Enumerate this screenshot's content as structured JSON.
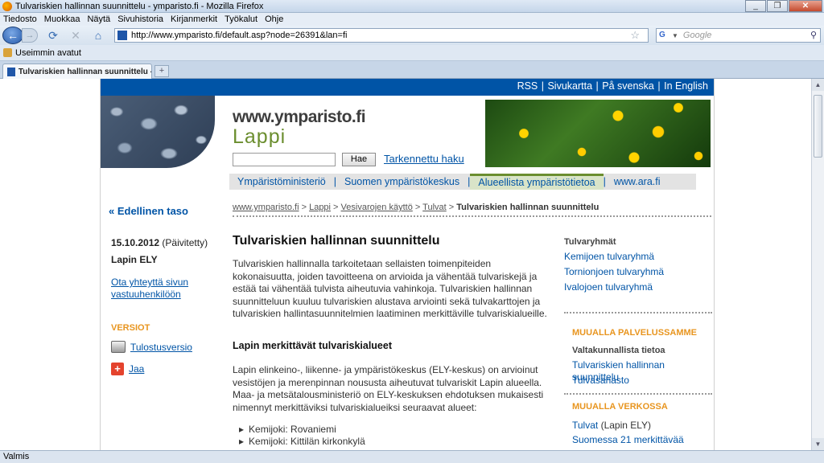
{
  "window": {
    "title": "Tulvariskien hallinnan suunnittelu - ymparisto.fi - Mozilla Firefox",
    "minimize": "_",
    "maximize": "❐",
    "close": "✕"
  },
  "menu": [
    "Tiedosto",
    "Muokkaa",
    "Näytä",
    "Sivuhistoria",
    "Kirjanmerkit",
    "Työkalut",
    "Ohje"
  ],
  "navbar": {
    "url": "http://www.ymparisto.fi/default.asp?node=26391&lan=fi",
    "search_placeholder": "Google"
  },
  "bookmarks": {
    "label": "Useimmin avatut"
  },
  "tab": {
    "label": "Tulvariskien hallinnan suunnittelu - y..."
  },
  "status": "Valmis",
  "page": {
    "top_links": [
      "RSS",
      "Sivukartta",
      "På svenska",
      "In English"
    ],
    "logo": {
      "domain": "www.ymparisto.fi",
      "region": "Lappi"
    },
    "search_button": "Hae",
    "advanced_search": "Tarkennettu haku",
    "main_nav": [
      "Ympäristöministeriö",
      "Suomen ympäristökeskus",
      "Alueellista ympäristötietoa",
      "www.ara.fi"
    ],
    "back_level": "« Edellinen taso",
    "breadcrumb": [
      "www.ymparisto.fi",
      "Lappi",
      "Vesivarojen käyttö",
      "Tulvat"
    ],
    "breadcrumb_current": "Tulvariskien hallinnan suunnittelu",
    "date": "15.10.2012",
    "date_note": "(Päivitetty)",
    "org": "Lapin ELY",
    "contact_link": "Ota yhteyttä sivun vastuuhenkilöön",
    "versions_title": "VERSIOT",
    "print_version": "Tulostusversio",
    "share": "Jaa",
    "title": "Tulvariskien hallinnan suunnittelu",
    "intro": "Tulvariskien hallinnalla tarkoitetaan sellaisten toimenpiteiden kokonaisuutta, joiden tavoitteena on arvioida ja vähentää tulvariskejä ja estää tai vähentää tulvista aiheutuvia vahinkoja. Tulvariskien hallinnan suunnitteluun kuuluu tulvariskien alustava arviointi sekä tulvakarttojen ja tulvariskien hallintasuunnitelmien laatiminen merkittäville tulvariskialueille.",
    "subtitle": "Lapin merkittävät tulvariskialueet",
    "sub_para": "Lapin elinkeino-, liikenne- ja ympäristökeskus (ELY-keskus) on arvioinut vesistöjen ja merenpinnan noususta aiheutuvat tulvariskit Lapin alueella. Maa- ja metsätalousministeriö on ELY-keskuksen ehdotuksen mukaisesti nimennyt merkittäviksi tulvariskialueiksi seuraavat alueet:",
    "bullets": [
      "Kemijoki: Rovaniemi",
      "Kemijoki: Kittilän kirkonkylä"
    ],
    "side": {
      "group_title": "Tulvaryhmät",
      "group_links": [
        "Kemijoen tulvaryhmä",
        "Tornionjoen tulvaryhmä",
        "Ivalojoen tulvaryhmä"
      ],
      "elsewhere_title": "MUUALLA PALVELUSSAMME",
      "national_label": "Valtakunnallista tietoa",
      "national_links": [
        "Tulvariskien hallinnan suunnittelu",
        "Tulvasanasto"
      ],
      "web_title": "MUUALLA VERKOSSA",
      "web_link": "Tulvat",
      "web_link_note": "(Lapin ELY)",
      "web_link2": "Suomessa 21 merkittävää"
    }
  }
}
